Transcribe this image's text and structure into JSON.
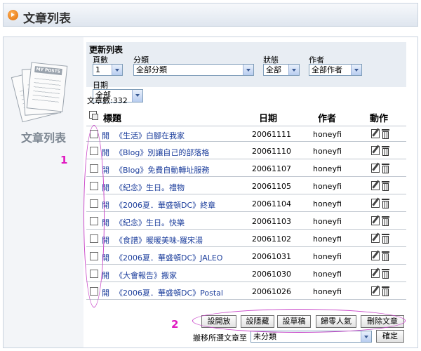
{
  "header": {
    "title": "文章列表"
  },
  "left_panel": {
    "title": "文章列表",
    "icon_stamp": "MY POSTS"
  },
  "filter": {
    "heading": "更新列表",
    "page_label": "頁數",
    "page_value": "1",
    "category_label": "分類",
    "category_value": "全部分類",
    "status_label": "狀態",
    "status_value": "全部",
    "author_label": "作者",
    "author_value": "全部作者",
    "date_label": "日期",
    "date_value": "全部"
  },
  "article_count": "文章數:332",
  "table": {
    "headers": {
      "title": "標題",
      "date": "日期",
      "author": "作者",
      "action": "動作"
    },
    "rows": [
      {
        "status": "開",
        "title": "《生活》白腳在我家",
        "date": "20061111",
        "author": "honeyfi"
      },
      {
        "status": "開",
        "title": "《Blog》別讓自己的部落格",
        "date": "20061110",
        "author": "honeyfi"
      },
      {
        "status": "開",
        "title": "《Blog》免費自動轉址服務",
        "date": "20061107",
        "author": "honeyfi"
      },
      {
        "status": "開",
        "title": "《紀念》生日。禮物",
        "date": "20061105",
        "author": "honeyfi"
      },
      {
        "status": "開",
        "title": "《2006夏．華盛頓DC》終章",
        "date": "20061104",
        "author": "honeyfi"
      },
      {
        "status": "開",
        "title": "《紀念》生日。快樂",
        "date": "20061103",
        "author": "honeyfi"
      },
      {
        "status": "開",
        "title": "《食譜》暖暖美味-羅宋湯",
        "date": "20061102",
        "author": "honeyfi"
      },
      {
        "status": "開",
        "title": "《2006夏．華盛頓DC》JALEO",
        "date": "20061031",
        "author": "honeyfi"
      },
      {
        "status": "開",
        "title": "《大會報告》搬家",
        "date": "20061030",
        "author": "honeyfi"
      },
      {
        "status": "開",
        "title": "《2006夏．華盛頓DC》Postal",
        "date": "20061026",
        "author": "honeyfi"
      }
    ]
  },
  "buttons": {
    "set_open": "設開放",
    "set_hidden": "設隱藏",
    "set_draft": "設草稿",
    "reset_popularity": "歸零人氣",
    "delete_article": "刪除文章"
  },
  "move": {
    "label": "搬移所選文章至",
    "category_value": "未分類",
    "confirm": "確定"
  },
  "annotations": {
    "mark1": "1",
    "mark2": "2"
  },
  "colors": {
    "link": "#1c3e9c",
    "annotation": "#e019c0",
    "panel": "#e8edf3"
  }
}
